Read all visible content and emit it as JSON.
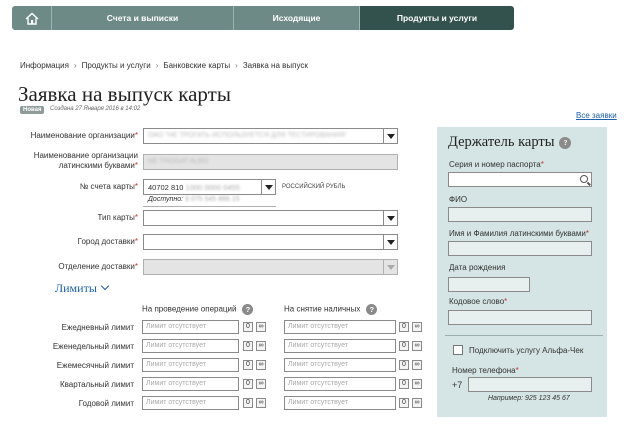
{
  "nav": {
    "tabs": [
      "Счета и выписки",
      "Исходящие",
      "Продукты и услуги"
    ],
    "active_index": 2
  },
  "breadcrumbs": [
    "Информация",
    "Продукты и услуги",
    "Банковские карты",
    "Заявка на выпуск"
  ],
  "page": {
    "title": "Заявка на выпуск карты",
    "status_badge": "Новая",
    "created": "Создана 27 Января 2016 в 14:02",
    "all_requests_link": "Все заявки"
  },
  "form": {
    "org_name": {
      "label": "Наименование организации",
      "required": "*",
      "value": "ОАО \"НЕ ТРОГАТЬ ИСПОЛЬЗУЕТСЯ ДЛЯ ТЕСТИРОВАНИЯ\""
    },
    "org_name_latin": {
      "label_line1": "Наименование организации",
      "label_line2": "латинскими буквами",
      "required": "*",
      "value": "NE TROGAT ALBO"
    },
    "account": {
      "label": "№ счета карты",
      "required": "*",
      "prefix": "40702 810",
      "masked": "1000 0000 0455",
      "currency": "РОССИЙСКИЙ РУБЛЬ",
      "available_label": "Доступно:",
      "available_value": "9 075 545 886.15"
    },
    "card_type": {
      "label": "Тип карты",
      "required": "*"
    },
    "delivery_city": {
      "label": "Город доставки",
      "required": "*"
    },
    "delivery_branch": {
      "label": "Отделение доставки",
      "required": "*"
    }
  },
  "limits": {
    "toggle_label": "Лимиты",
    "col_operations": "На проведение операций",
    "col_cash": "На снятие наличных",
    "placeholder": "Лимит отсутствует",
    "zero_btn": "0",
    "inf_btn": "∞",
    "rows": [
      "Ежедневный лимит",
      "Еженедельный лимит",
      "Ежемесячный лимит",
      "Квартальный лимит",
      "Годовой лимит"
    ]
  },
  "holder": {
    "title": "Держатель карты",
    "passport_label": "Серия и номер паспорта",
    "fio_label": "ФИО",
    "latin_name_label": "Имя и Фамилия латинскими буквами",
    "birth_label": "Дата рождения",
    "code_word_label": "Кодовое слово",
    "alfa_check_label": "Подключить услугу Альфа-Чек",
    "phone_label": "Номер телефона",
    "phone_prefix": "+7",
    "phone_example": "Например: 925 123 45 67",
    "required": "*"
  },
  "colors": {
    "nav_bg": "#6d8a86",
    "nav_active": "#33524e",
    "link": "#1d5fa8",
    "panel_bg": "#d5e4e4",
    "required": "#c0392b"
  }
}
